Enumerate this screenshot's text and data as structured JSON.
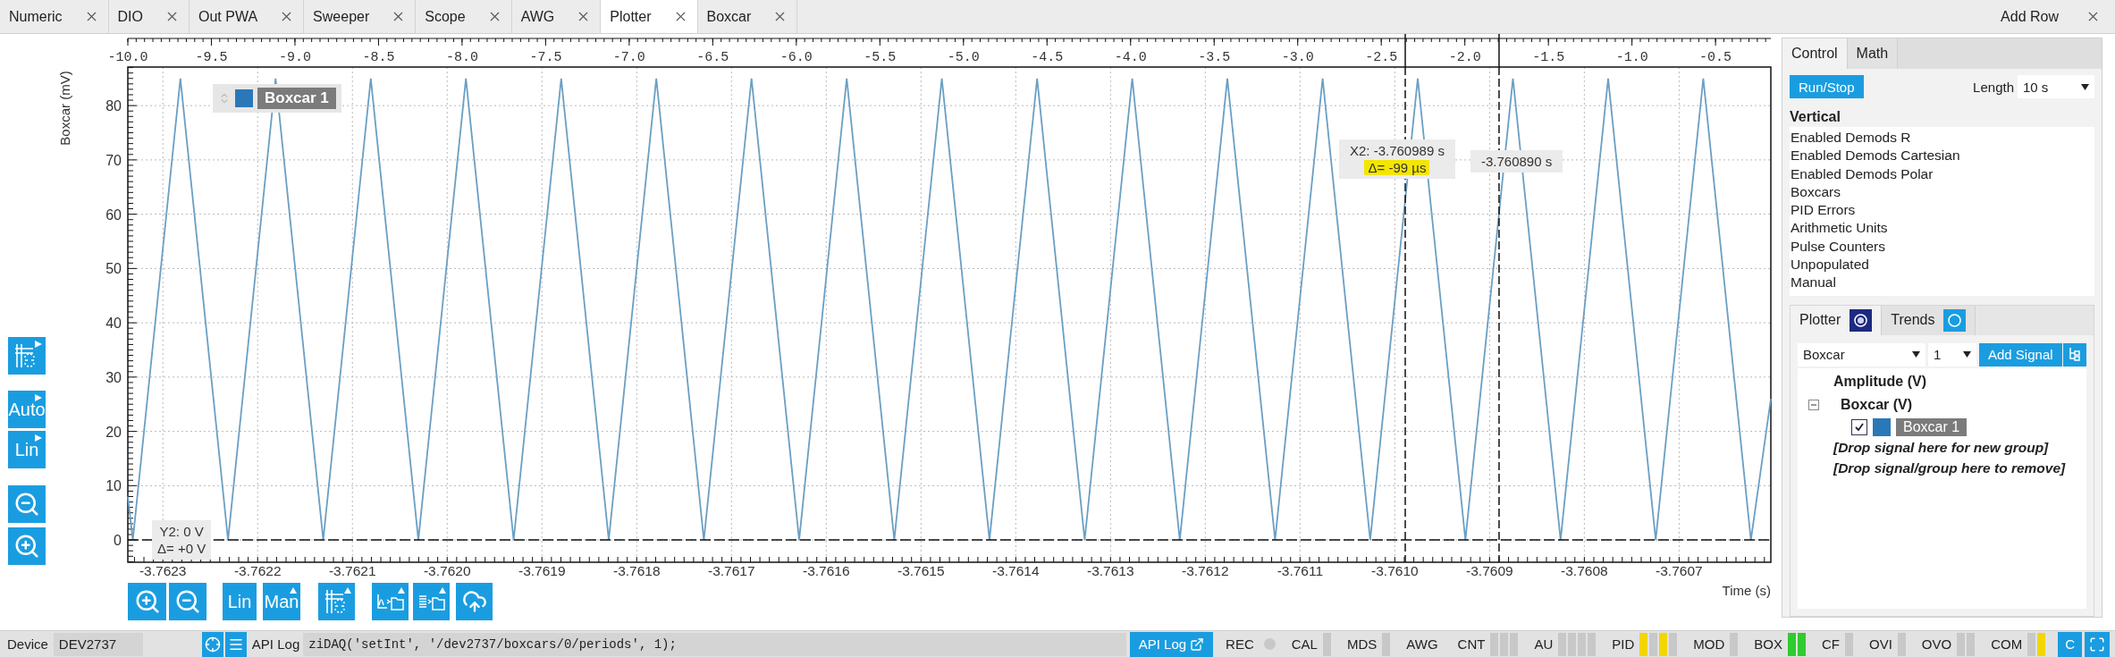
{
  "tabs": [
    {
      "label": "Numeric",
      "selected": false
    },
    {
      "label": "DIO",
      "selected": false
    },
    {
      "label": "Out PWA",
      "selected": false
    },
    {
      "label": "Sweeper",
      "selected": false
    },
    {
      "label": "Scope",
      "selected": false
    },
    {
      "label": "AWG",
      "selected": false
    },
    {
      "label": "Plotter",
      "selected": true
    },
    {
      "label": "Boxcar",
      "selected": false
    }
  ],
  "add_row": "Add Row",
  "left_toolbar": {
    "range_button": "Auto",
    "scale_button": "Lin"
  },
  "plot": {
    "legend": {
      "color": "#2a78b8"
    },
    "cursor_readouts": {
      "x_delta": "Δ= -99 µs",
      "y_delta": "Δ= +0 V"
    },
    "top_axis": {
      "labels": [
        "-10.0",
        "-9.5",
        "-9.0",
        "-8.5",
        "-8.0",
        "-7.5",
        "-7.0",
        "-6.5",
        "-6.0",
        "-5.5",
        "-5.0",
        "-4.5",
        "-4.0",
        "-3.5",
        "-3.0",
        "-2.5",
        "-2.0",
        "-1.5",
        "-1.0",
        "-0.5"
      ]
    },
    "chart_data": {
      "type": "line",
      "grid": true,
      "xlabel": "Time (s)",
      "ylabel": "Boxcar (mV)",
      "x": [
        -3.762337,
        -3.7623317,
        -3.7622815,
        -3.7622313,
        -3.7621811,
        -3.7621308,
        -3.7620806,
        -3.7620304,
        -3.7619802,
        -3.7619299,
        -3.7618797,
        -3.7618295,
        -3.7617793,
        -3.7617291,
        -3.7616789,
        -3.7616286,
        -3.7615784,
        -3.7615282,
        -3.761478,
        -3.7614277,
        -3.7613775,
        -3.7613273,
        -3.7612771,
        -3.7612269,
        -3.7611767,
        -3.7611264,
        -3.7610762,
        -3.761026,
        -3.7609758,
        -3.7609255,
        -3.7608753,
        -3.7608251,
        -3.7607749,
        -3.7607247,
        -3.7606745,
        -3.7606242,
        -3.7606032
      ],
      "series": [
        {
          "name": "Boxcar 1",
          "color": "#6a9fc4",
          "values": [
            8,
            0,
            85,
            0,
            85,
            0,
            85,
            0,
            85,
            0,
            85,
            0,
            85,
            0,
            85,
            0,
            85,
            0,
            85,
            0,
            85,
            0,
            85,
            0,
            85,
            0,
            85,
            0,
            85,
            0,
            85,
            0,
            85,
            0,
            85,
            0,
            26
          ]
        }
      ],
      "xlim": [
        -3.762337,
        -3.7606032
      ],
      "ylim": [
        -4.1,
        87.1
      ],
      "xticks": [
        {
          "value": -3.7623,
          "label": "-3.7623"
        },
        {
          "value": -3.7622,
          "label": "-3.7622"
        },
        {
          "value": -3.7621,
          "label": "-3.7621"
        },
        {
          "value": -3.762,
          "label": "-3.7620"
        },
        {
          "value": -3.7619,
          "label": "-3.7619"
        },
        {
          "value": -3.7618,
          "label": "-3.7618"
        },
        {
          "value": -3.7617,
          "label": "-3.7617"
        },
        {
          "value": -3.7616,
          "label": "-3.7616"
        },
        {
          "value": -3.7615,
          "label": "-3.7615"
        },
        {
          "value": -3.7614,
          "label": "-3.7614"
        },
        {
          "value": -3.7613,
          "label": "-3.7613"
        },
        {
          "value": -3.7612,
          "label": "-3.7612"
        },
        {
          "value": -3.7611,
          "label": "-3.7611"
        },
        {
          "value": -3.761,
          "label": "-3.7610"
        },
        {
          "value": -3.7609,
          "label": "-3.7609"
        },
        {
          "value": -3.7608,
          "label": "-3.7608"
        },
        {
          "value": -3.7607,
          "label": "-3.7607"
        }
      ],
      "yticks": [
        0,
        10,
        20,
        30,
        40,
        50,
        60,
        70,
        80
      ],
      "ref_lines": [
        {
          "axis": "x",
          "value": -3.760989
        },
        {
          "axis": "x",
          "value": -3.76089
        },
        {
          "axis": "y",
          "value": 0
        }
      ],
      "annotations": [
        "X2: -3.760989 s",
        "-3.760890 s",
        "Y2: 0 V"
      ]
    }
  },
  "bottom_toolbar": {
    "scale_button": "Lin",
    "range_button": "Man"
  },
  "control_panel": {
    "tabs": [
      {
        "label": "Control",
        "selected": true
      },
      {
        "label": "Math",
        "selected": false
      }
    ],
    "run_button": "Run/Stop",
    "length_label": "Length",
    "length_value": "10 s",
    "vertical_title": "Vertical",
    "vertical_items": [
      "Enabled Demods R",
      "Enabled Demods Cartesian",
      "Enabled Demods Polar",
      "Boxcars",
      "PID Errors",
      "Arithmetic Units",
      "Pulse Counters",
      "Unpopulated",
      "Manual"
    ]
  },
  "signal_panel": {
    "tabs": [
      {
        "label": "Plotter",
        "selected": true
      },
      {
        "label": "Trends",
        "selected": false
      }
    ],
    "module_value": "Boxcar",
    "channel_value": "1",
    "add_button": "Add Signal",
    "tree": [
      {
        "kind": "group",
        "label": "Amplitude (V)"
      },
      {
        "kind": "group",
        "label": "Boxcar (V)",
        "expanded": true,
        "children": [
          {
            "label": "Boxcar 1",
            "checked": true,
            "color": "#2a78b8"
          }
        ]
      },
      {
        "kind": "drop",
        "label": "[Drop signal here for new group]"
      },
      {
        "kind": "drop",
        "label": "[Drop signal/group here to remove]"
      }
    ]
  },
  "status_bar": {
    "device_label": "Device",
    "device": "DEV2737",
    "api_log_label": "API Log",
    "api_log_text": "ziDAQ('setInt', '/dev2737/boxcars/0/periods', 1);",
    "api_log_button": "API Log",
    "indicators": [
      {
        "kind": "dot",
        "label": "REC"
      },
      {
        "kind": "lights",
        "label": "CAL",
        "lights": [
          {
            "color": "#c8c8c8"
          }
        ]
      },
      {
        "kind": "lights",
        "label": "MDS",
        "lights": [
          {
            "color": "#c8c8c8"
          }
        ]
      },
      {
        "kind": "text",
        "label": "AWG"
      },
      {
        "kind": "lights",
        "label": "CNT",
        "lights": [
          {
            "color": "#c8c8c8"
          },
          {
            "color": "#c8c8c8"
          },
          {
            "color": "#c8c8c8"
          }
        ]
      },
      {
        "kind": "lights",
        "label": "AU",
        "lights": [
          {
            "color": "#c8c8c8"
          },
          {
            "color": "#c8c8c8"
          },
          {
            "color": "#c8c8c8"
          },
          {
            "color": "#c8c8c8"
          }
        ]
      },
      {
        "kind": "lights",
        "label": "PID",
        "lights": [
          {
            "color": "#f2d600"
          },
          {
            "color": "#c8c8c8"
          },
          {
            "color": "#f2d600"
          },
          {
            "color": "#c8c8c8"
          }
        ]
      },
      {
        "kind": "lights",
        "label": "MOD",
        "lights": [
          {
            "color": "#c8c8c8"
          }
        ]
      },
      {
        "kind": "lights",
        "label": "BOX",
        "lights": [
          {
            "color": "#2ecc2e"
          },
          {
            "color": "#2ecc2e"
          }
        ]
      },
      {
        "kind": "lights",
        "label": "CF",
        "lights": [
          {
            "color": "#c8c8c8"
          }
        ]
      },
      {
        "kind": "lights",
        "label": "OVI",
        "lights": [
          {
            "color": "#c8c8c8"
          }
        ]
      },
      {
        "kind": "lights",
        "label": "OVO",
        "lights": [
          {
            "color": "#c8c8c8"
          },
          {
            "color": "#c8c8c8"
          }
        ]
      },
      {
        "kind": "lights",
        "label": "COM",
        "lights": [
          {
            "color": "#c8c8c8"
          },
          {
            "color": "#f2d600"
          }
        ]
      }
    ],
    "c_button": "C"
  }
}
